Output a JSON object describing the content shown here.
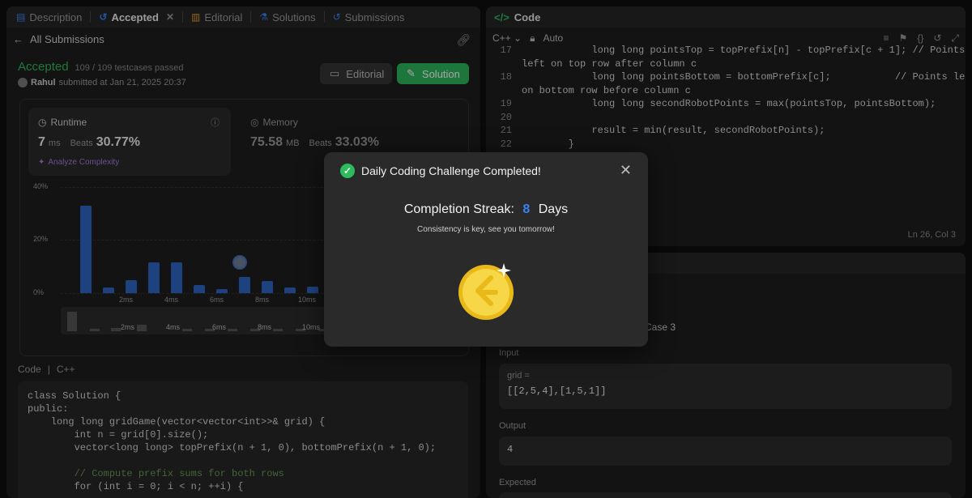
{
  "tabs": [
    {
      "label": "Description",
      "icon": "document-icon"
    },
    {
      "label": "Accepted",
      "icon": "history-icon"
    },
    {
      "label": "Editorial",
      "icon": "book-icon"
    },
    {
      "label": "Solutions",
      "icon": "flask-icon"
    },
    {
      "label": "Submissions",
      "icon": "history-icon"
    }
  ],
  "back_label": "All Submissions",
  "submission": {
    "status": "Accepted",
    "testcases": "109 / 109 testcases passed",
    "user": "Rahul",
    "submitted_text": "submitted at Jan 21, 2025 20:37"
  },
  "buttons": {
    "editorial": "Editorial",
    "solution": "Solution"
  },
  "runtime": {
    "label": "Runtime",
    "value": "7",
    "unit": "ms",
    "beats_label": "Beats",
    "beats": "30.77%",
    "analyze": "Analyze Complexity"
  },
  "memory": {
    "label": "Memory",
    "value": "75.58",
    "unit": "MB",
    "beats_label": "Beats",
    "beats": "33.03%"
  },
  "chart_data": {
    "type": "bar",
    "ylabels": [
      "40%",
      "20%",
      "0%"
    ],
    "xlabels": [
      "2ms",
      "4ms",
      "6ms",
      "8ms",
      "10ms"
    ],
    "values": [
      33,
      2,
      5,
      11.5,
      11.5,
      3,
      1.5,
      6,
      4.5,
      2,
      2.5,
      2
    ],
    "ylim": [
      0,
      40
    ]
  },
  "code_section": {
    "title": "Code",
    "lang": "C++"
  },
  "code_lines": [
    "class Solution {",
    "public:",
    "    long long gridGame(vector<vector<int>>& grid) {",
    "        int n = grid[0].size();",
    "        vector<long long> topPrefix(n + 1, 0), bottomPrefix(n + 1, 0);",
    "",
    "        // Compute prefix sums for both rows",
    "        for (int i = 0; i < n; ++i) {"
  ],
  "editor": {
    "title": "Code",
    "lang": "C++",
    "mode": "Auto",
    "cursor": "Ln 26, Col 3",
    "lines": [
      {
        "n": "17",
        "t": "            long long pointsTop = topPrefix[n] - topPrefix[c + 1]; // Points"
      },
      {
        "n": "",
        "t": "left on top row after column c"
      },
      {
        "n": "18",
        "t": "            long long pointsBottom = bottomPrefix[c];           // Points left"
      },
      {
        "n": "",
        "t": "on bottom row before column c"
      },
      {
        "n": "19",
        "t": "            long long secondRobotPoints = max(pointsTop, pointsBottom);"
      },
      {
        "n": "20",
        "t": ""
      },
      {
        "n": "21",
        "t": "            result = min(result, secondRobotPoints);"
      },
      {
        "n": "22",
        "t": "        }"
      }
    ]
  },
  "testcase": {
    "case_label": "Case 3",
    "input_label": "Input",
    "grid_label": "grid =",
    "grid_value": "[[2,5,4],[1,5,1]]",
    "output_label": "Output",
    "output_value": "4",
    "expected_label": "Expected"
  },
  "modal": {
    "title": "Daily Coding Challenge Completed!",
    "streak_label": "Completion Streak:",
    "streak_value": "8",
    "streak_unit": "Days",
    "tagline": "Consistency is key, see you tomorrow!"
  }
}
